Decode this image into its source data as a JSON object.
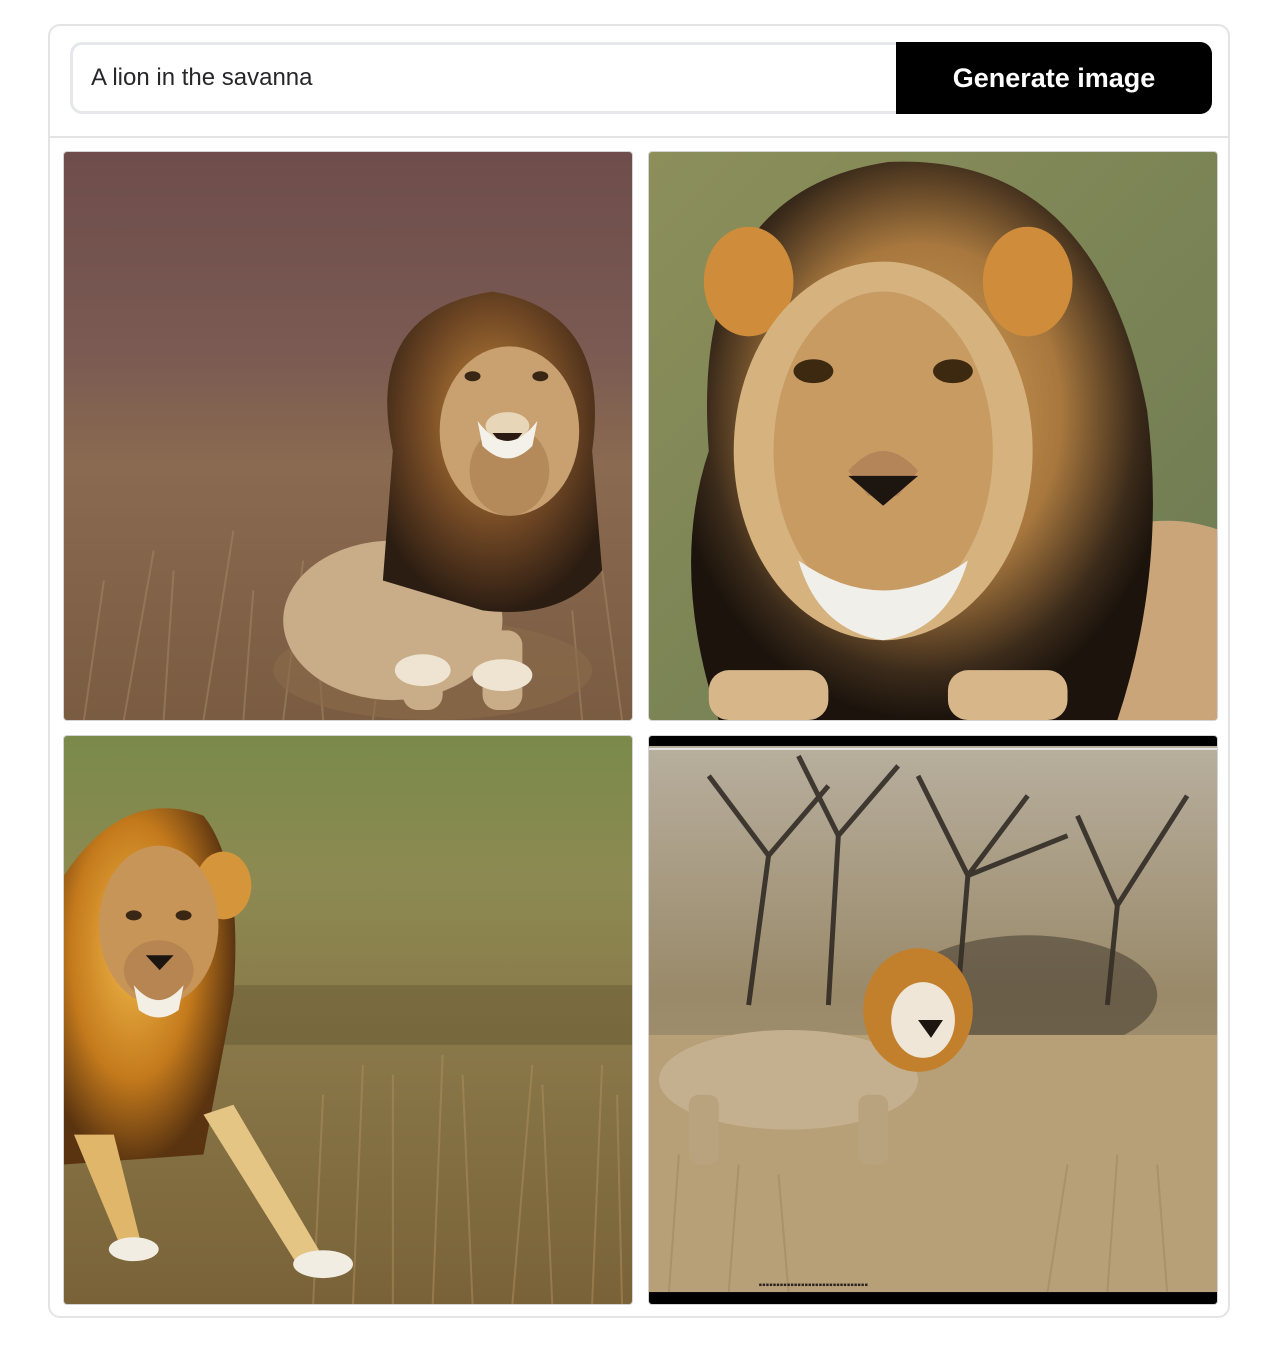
{
  "prompt": {
    "value": "A lion in the savanna",
    "button_label": "Generate image"
  },
  "results": [
    {
      "subject": "lion-sitting-in-grass"
    },
    {
      "subject": "lion-face-closeup"
    },
    {
      "subject": "lion-walking-toward-viewer"
    },
    {
      "subject": "lion-under-acacia-trees"
    }
  ]
}
